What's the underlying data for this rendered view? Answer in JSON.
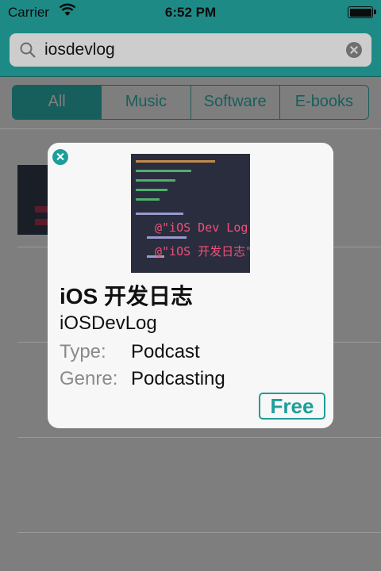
{
  "status_bar": {
    "carrier": "Carrier",
    "time": "6:52 PM"
  },
  "search": {
    "query": "iosdevlog"
  },
  "segments": [
    "All",
    "Music",
    "Software",
    "E-books"
  ],
  "selected_segment": "All",
  "popup": {
    "title": "iOS 开发日志",
    "artist": "iOSDevLog",
    "type_label": "Type:",
    "type_value": "Podcast",
    "genre_label": "Genre:",
    "genre_value": "Podcasting",
    "price": "Free",
    "artwork_lines": [
      "@\"iOS Dev Log\"",
      "@\"iOS 开发日志\""
    ]
  },
  "colors": {
    "accent": "#1e9e99",
    "header": "#1e8a86"
  }
}
